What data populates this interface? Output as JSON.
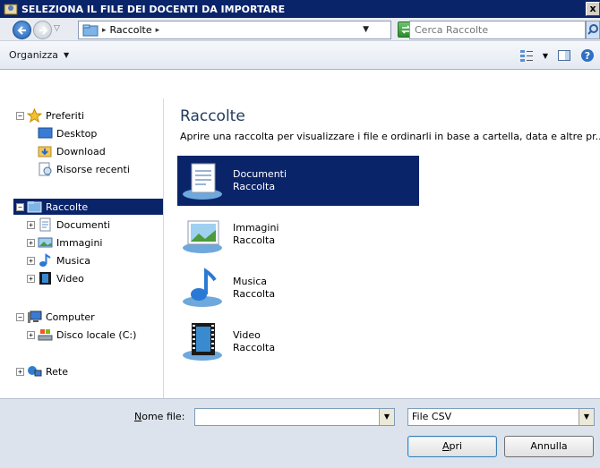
{
  "window": {
    "title": "SELEZIONA IL FILE DEI DOCENTI DA IMPORTARE",
    "close_glyph": "x"
  },
  "address": {
    "breadcrumb": [
      "Raccolte"
    ],
    "search_placeholder": "Cerca Raccolte"
  },
  "toolbar": {
    "organize_label": "Organizza"
  },
  "nav": {
    "favorites": {
      "label": "Preferiti",
      "items": [
        "Desktop",
        "Download",
        "Risorse recenti"
      ]
    },
    "libraries": {
      "label": "Raccolte",
      "items": [
        "Documenti",
        "Immagini",
        "Musica",
        "Video"
      ]
    },
    "computer": {
      "label": "Computer",
      "items": [
        "Disco locale (C:)"
      ]
    },
    "network": {
      "label": "Rete"
    }
  },
  "content": {
    "heading": "Raccolte",
    "description": "Aprire una raccolta per visualizzare i file e ordinarli in base a cartella, data e altre pr...",
    "libraries": [
      {
        "name": "Documenti",
        "type": "Raccolta",
        "icon": "documents-library-icon",
        "selected": true
      },
      {
        "name": "Immagini",
        "type": "Raccolta",
        "icon": "pictures-library-icon",
        "selected": false
      },
      {
        "name": "Musica",
        "type": "Raccolta",
        "icon": "music-library-icon",
        "selected": false
      },
      {
        "name": "Video",
        "type": "Raccolta",
        "icon": "video-library-icon",
        "selected": false
      }
    ]
  },
  "footer": {
    "filename_label_accel": "N",
    "filename_label_rest": "ome file:",
    "filename_value": "",
    "filetype_value": "File CSV",
    "open_label_accel": "A",
    "open_label_rest": "pri",
    "cancel_label": "Annulla"
  },
  "colors": {
    "selection": "#0a246a",
    "heading": "#1e395b",
    "footer_bg": "#dde3ec"
  }
}
